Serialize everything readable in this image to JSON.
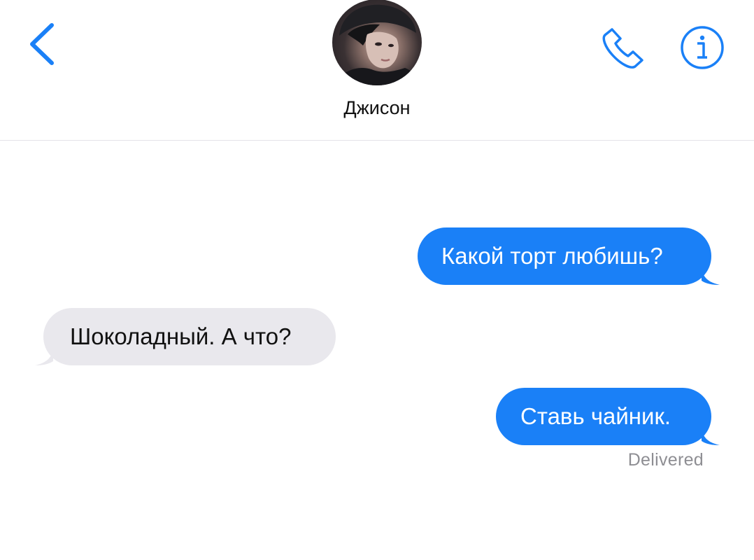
{
  "header": {
    "contact_name": "Джисон",
    "icons": {
      "back": "chevron-left-icon",
      "phone": "phone-icon",
      "info": "info-icon",
      "avatar": "avatar-photo"
    },
    "accent_color": "#1a80f7"
  },
  "messages": [
    {
      "direction": "outgoing",
      "text": "Какой торт любишь?"
    },
    {
      "direction": "incoming",
      "text": "Шоколадный. А что?"
    },
    {
      "direction": "outgoing",
      "text": "Ставь чайник."
    }
  ],
  "status": "Delivered",
  "colors": {
    "outgoing_bubble": "#1a80f7",
    "incoming_bubble": "#e9e8ed",
    "status_text": "#8e8e93"
  }
}
